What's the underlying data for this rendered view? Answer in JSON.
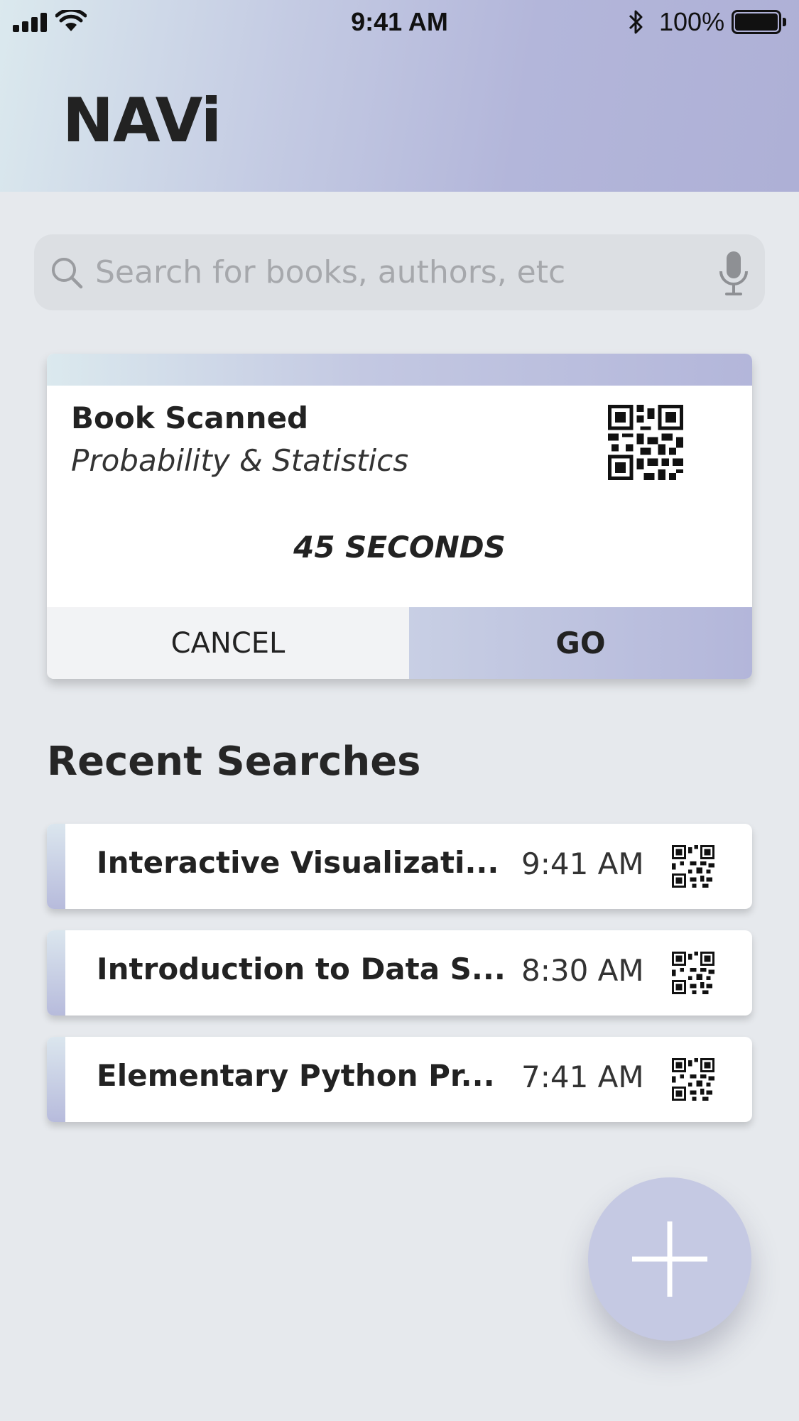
{
  "status_bar": {
    "time": "9:41 AM",
    "battery_percent": "100%",
    "signal_icon": "signal-bars-icon",
    "wifi_icon": "wifi-icon",
    "bluetooth_icon": "bluetooth-icon",
    "battery_icon": "battery-icon"
  },
  "app": {
    "title": "NAVi"
  },
  "search": {
    "placeholder": "Search for books, authors, etc",
    "value": "",
    "icon": "search-icon",
    "mic_icon": "microphone-icon"
  },
  "scan_card": {
    "title": "Book Scanned",
    "subtitle": "Probability & Statistics",
    "timer": "45 SECONDS",
    "qr_icon": "qr-code-icon",
    "cancel_label": "CANCEL",
    "go_label": "GO"
  },
  "recent": {
    "title": "Recent Searches",
    "items": [
      {
        "name": "Interactive Visualizati...",
        "time": "9:41 AM",
        "icon": "qr-code-icon"
      },
      {
        "name": "Introduction to Data S...",
        "time": "8:30 AM",
        "icon": "qr-code-icon"
      },
      {
        "name": "Elementary Python Pr...",
        "time": "7:41 AM",
        "icon": "qr-code-icon"
      }
    ]
  },
  "fab": {
    "icon": "plus-icon"
  },
  "colors": {
    "header_gradient_start": "#dbe9ee",
    "header_gradient_end": "#aeb0d6",
    "background": "#e6e9ed",
    "accent": "#b3b6da",
    "fab": "#c5c9e3"
  }
}
